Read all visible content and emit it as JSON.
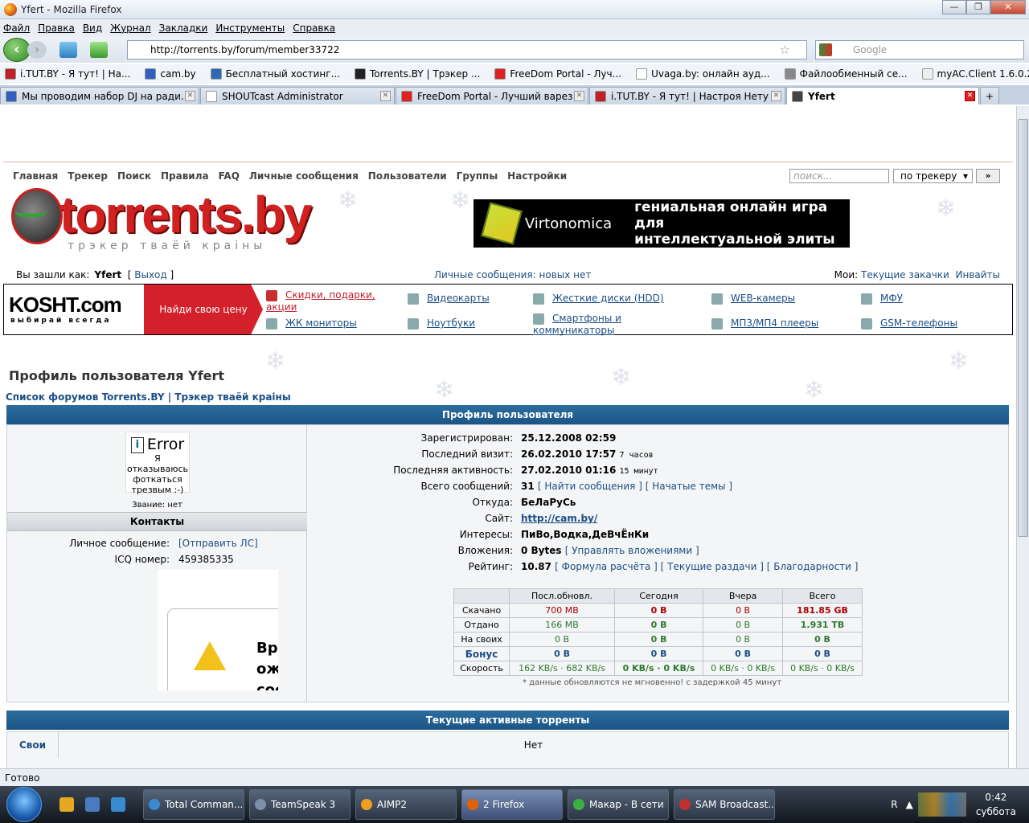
{
  "window": {
    "title": "Yfert - Mozilla Firefox",
    "min": "—",
    "max": "❐",
    "close": "✕"
  },
  "menu": [
    "Файл",
    "Правка",
    "Вид",
    "Журнал",
    "Закладки",
    "Инструменты",
    "Справка"
  ],
  "nav": {
    "url": "http://torrents.by/forum/member33722",
    "search_placeholder": "Google"
  },
  "bookmarks": [
    {
      "label": "i.TUT.BY - Я тут! | На...",
      "color": "#c0202a"
    },
    {
      "label": "cam.by",
      "color": "#3060c0"
    },
    {
      "label": "Бесплатный хостинг...",
      "color": "#2d6ab3"
    },
    {
      "label": "Torrents.BY | Трэкер ...",
      "color": "#222"
    },
    {
      "label": "FreeDom Portal - Луч...",
      "color": "#d22"
    },
    {
      "label": "Uvaga.by: онлайн ауд...",
      "color": "#fff"
    },
    {
      "label": "Файлообменный се...",
      "color": "#888"
    },
    {
      "label": "myAC.Client 1.6.0.2",
      "color": "#eee"
    }
  ],
  "tabs": [
    {
      "label": "Мы проводим набор DJ на ради...",
      "color": "#3060c0",
      "active": false
    },
    {
      "label": "SHOUTcast Administrator",
      "color": "#fff",
      "active": false
    },
    {
      "label": "FreeDom Portal - Лучший варез ...",
      "color": "#d22",
      "active": false
    },
    {
      "label": "i.TUT.BY - Я тут! | Настроя Нету",
      "color": "#c0202a",
      "active": false
    },
    {
      "label": "Yfert",
      "color": "#444",
      "active": true
    }
  ],
  "site": {
    "topnav": [
      "Главная",
      "Трекер",
      "Поиск",
      "Правила",
      "FAQ",
      "Личные сообщения",
      "Пользователи",
      "Группы",
      "Настройки"
    ],
    "search_placeholder": "поиск...",
    "search_scope": "по трекеру",
    "search_go": "»",
    "logo_name": "torrents.by",
    "logo_tag": "трэкер тваёй краіны",
    "banner_brand": "Virtonomica",
    "banner_slogan_1": "гениальная онлайн игра для",
    "banner_slogan_2": "интеллектуальной элиты",
    "login_prefix": "Вы зашли как:",
    "login_user": "Yfert",
    "logout": "Выход",
    "pm_status": "Личные сообщения: новых нет",
    "mine_label": "Мои:",
    "mine_downloads": "Текущие закачки",
    "mine_invites": "Инвайты"
  },
  "kosht": {
    "logo": "KOSHT.com",
    "sub": "выбирай всегда",
    "find": "Найди свою цену",
    "links": [
      "Скидки, подарки, акции",
      "Видеокарты",
      "Жесткие диски (HDD)",
      "WEB-камеры",
      "МФУ",
      "ЖК мониторы",
      "Ноутбуки",
      "Смартфоны и коммуникаторы",
      "МП3/МП4 плееры",
      "GSM-телефоны"
    ]
  },
  "profile": {
    "title": "Профиль пользователя Yfert",
    "crumbs": "Список форумов Torrents.BY | Трэкер тваёй краіны",
    "section": "Профиль пользователя",
    "avatar_error": "Error",
    "avatar_text_1": "Я отказываюсь",
    "avatar_text_2": "фоткаться",
    "avatar_text_3": "трезвым :-)",
    "rank": "Звание: нет",
    "contacts": "Контакты",
    "pm_label": "Личное сообщение:",
    "pm_link": "[Отправить ЛС]",
    "icq_label": "ICQ номер:",
    "icq": "459385335",
    "flash_text_1": "Вре",
    "flash_text_2": "ож",
    "flash_text_3": "сос",
    "reg_label": "Зарегистрирован:",
    "reg": "25.12.2008 02:59",
    "visit_label": "Последний визит:",
    "visit": "26.02.2010 17:57",
    "visit_ago": "7 часов",
    "act_label": "Последняя активность:",
    "act": "27.02.2010 01:16",
    "act_ago": "15 минут",
    "posts_label": "Всего сообщений:",
    "posts": "31",
    "find_posts": "Найти сообщения",
    "start_topics": "Начатые темы",
    "from_label": "Откуда:",
    "from": "БеЛаРуСь",
    "site_label": "Сайт:",
    "site": "http://cam.by/",
    "int_label": "Интересы:",
    "interests": "ПиВо,Водка,ДеВчЁнКи",
    "att_label": "Вложения:",
    "att": "0 Bytes",
    "att_manage": "Управлять вложениями",
    "rating_label": "Рейтинг:",
    "rating": "10.87",
    "rating_formula": "Формула расчёта",
    "rating_current": "Текущие раздачи",
    "rating_thanks": "Благодарности"
  },
  "stats": {
    "headers": [
      "",
      "Посл.обновл.",
      "Сегодня",
      "Вчера",
      "Всего"
    ],
    "rows": [
      {
        "label": "Скачано",
        "cells": [
          "700 MB",
          "0 B",
          "0 B",
          "181.85 GB"
        ]
      },
      {
        "label": "Отдано",
        "cells": [
          "166 MB",
          "0 B",
          "0 B",
          "1.931 TB"
        ]
      },
      {
        "label": "На своих",
        "cells": [
          "0 B",
          "0 B",
          "0 B",
          "0 B"
        ]
      },
      {
        "label": "Бонус",
        "cells": [
          "0 B",
          "0 B",
          "0 B",
          "0 B"
        ]
      },
      {
        "label": "Скорость",
        "cells": [
          "162 KB/s · 682 KB/s",
          "0 KB/s · 0 KB/s",
          "0 KB/s · 0 KB/s",
          "0 KB/s · 0 KB/s"
        ]
      }
    ],
    "note": "* данные обновляются не мгновенно! с задержкой 45 минут"
  },
  "torrents": {
    "section": "Текущие активные торренты",
    "own": "Свои",
    "none": "Нет"
  },
  "status": "Готово",
  "taskbar": {
    "tasks": [
      {
        "label": "Total Comman...",
        "active": false,
        "color": "#3a8ad0"
      },
      {
        "label": "TeamSpeak 3",
        "active": false,
        "color": "#7a8fa8"
      },
      {
        "label": "AIMP2",
        "active": false,
        "color": "#f0a020"
      },
      {
        "label": "2 Firefox",
        "active": true,
        "color": "#e0610a"
      },
      {
        "label": "Макар - В сети",
        "active": false,
        "color": "#3cb043"
      },
      {
        "label": "SAM Broadcast...",
        "active": false,
        "color": "#c03030"
      }
    ],
    "lang": "R",
    "time": "0:42",
    "day": "суббота"
  }
}
